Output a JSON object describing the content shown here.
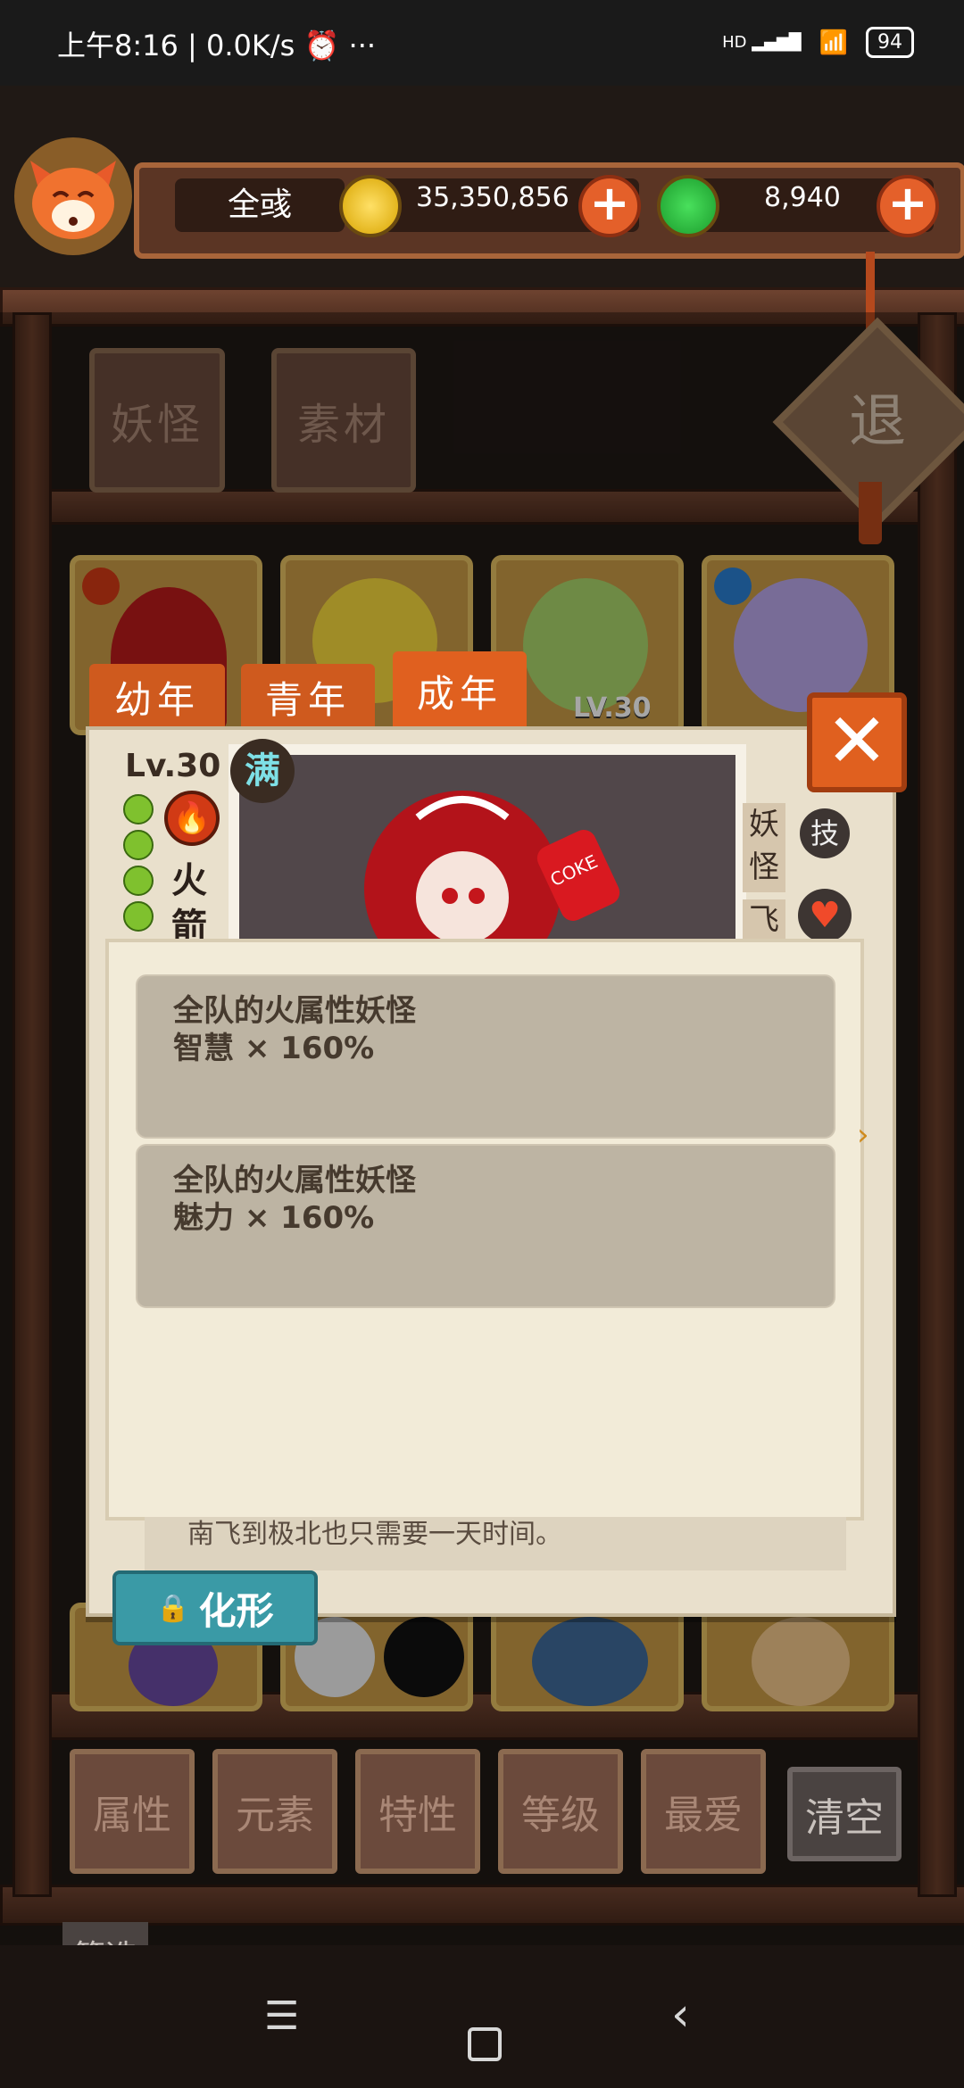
{
  "status_bar": {
    "time": "上午8:16",
    "speed": "0.0K/s",
    "alarm_icon": "alarm-icon",
    "more": "···",
    "network": "HD",
    "battery": "94"
  },
  "player": {
    "name": "全彧",
    "gold": "35,350,856",
    "jade": "8,940"
  },
  "top_tabs": [
    "妖怪",
    "素材"
  ],
  "retreat_label": "退",
  "detail": {
    "age_tabs": [
      "幼年",
      "青年",
      "成年"
    ],
    "level": "Lv.30",
    "full_badge": "满",
    "element_icon": "fire-icon",
    "name_chars": [
      "火",
      "箭"
    ],
    "side_tags": [
      "妖",
      "怪",
      "飞"
    ],
    "skill_badge": "技",
    "card_level_badge": "LV.30",
    "bottle_label": "COKE",
    "skills": [
      {
        "line1": "全队的火属性妖怪",
        "line2": "智慧 × 160%"
      },
      {
        "line1": "全队的火属性妖怪",
        "line2": "魅力 × 160%"
      }
    ],
    "description": "南飞到极北也只需要一天时间。",
    "transform_label": "化形"
  },
  "filters": [
    "属性",
    "元素",
    "特性",
    "等级",
    "最爱",
    "清空"
  ],
  "filter_label": "筛选",
  "colors": {
    "accent_orange": "#e0601f",
    "wood_dark": "#2b1710",
    "parchment": "#e9e0cc",
    "skill_box": "#bdb4a3",
    "teal_button": "#3a9aa6"
  }
}
